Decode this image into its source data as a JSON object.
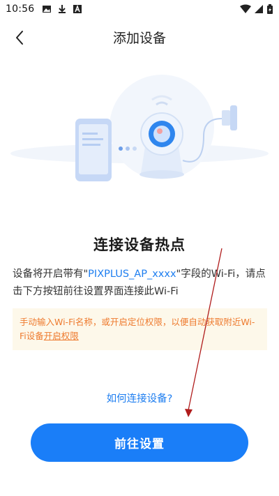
{
  "status_bar": {
    "time": "10:56",
    "left_icons": [
      "image-icon",
      "download-icon",
      "app-icon"
    ],
    "right_icons": [
      "wifi-icon",
      "signal-icon",
      "battery-icon"
    ]
  },
  "header": {
    "title": "添加设备",
    "back_icon": "chevron-left-icon"
  },
  "main": {
    "heading": "连接设备热点",
    "description_prefix": "设备将开启带有\"",
    "description_highlight": "PIXPLUS_AP_xxxx",
    "description_suffix": "\"字段的Wi-Fi，请点击下方按钮前往设置界面连接此Wi-Fi",
    "notice_text": "手动输入Wi-Fi名称，或开启定位权限，以便自动获取附近Wi-Fi设备",
    "notice_link": "开启权限",
    "help_link": "如何连接设备?",
    "primary_button": "前往设置"
  },
  "colors": {
    "accent": "#1a7ef8",
    "link": "#1e7ef0",
    "notice_text": "#ee7a2e",
    "notice_bg": "#fdf8ea",
    "annotation_arrow": "#b01c1c"
  }
}
